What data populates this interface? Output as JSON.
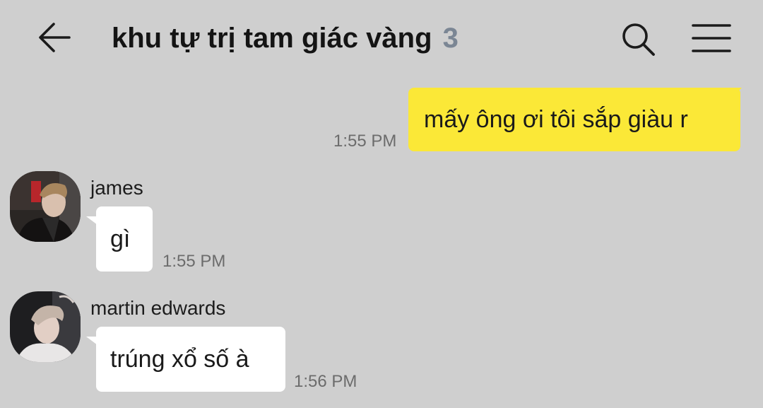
{
  "header": {
    "back_icon": "arrow-left-icon",
    "title": "khu tự trị tam giác vàng",
    "member_count": "3",
    "search_icon": "search-icon",
    "menu_icon": "hamburger-menu-icon"
  },
  "messages": [
    {
      "direction": "outgoing",
      "text": "mấy ông ơi tôi sắp giàu r",
      "time": "1:55 PM",
      "bubble_color": "#fbe837"
    },
    {
      "direction": "incoming",
      "sender": "james",
      "text": "gì",
      "time": "1:55 PM"
    },
    {
      "direction": "incoming",
      "sender": "martin edwards",
      "text": "trúng xổ số à",
      "time": "1:56 PM"
    }
  ],
  "colors": {
    "background": "#cfcfcf",
    "outgoing_bubble": "#fbe837",
    "incoming_bubble": "#ffffff",
    "member_count": "#7b8694"
  }
}
